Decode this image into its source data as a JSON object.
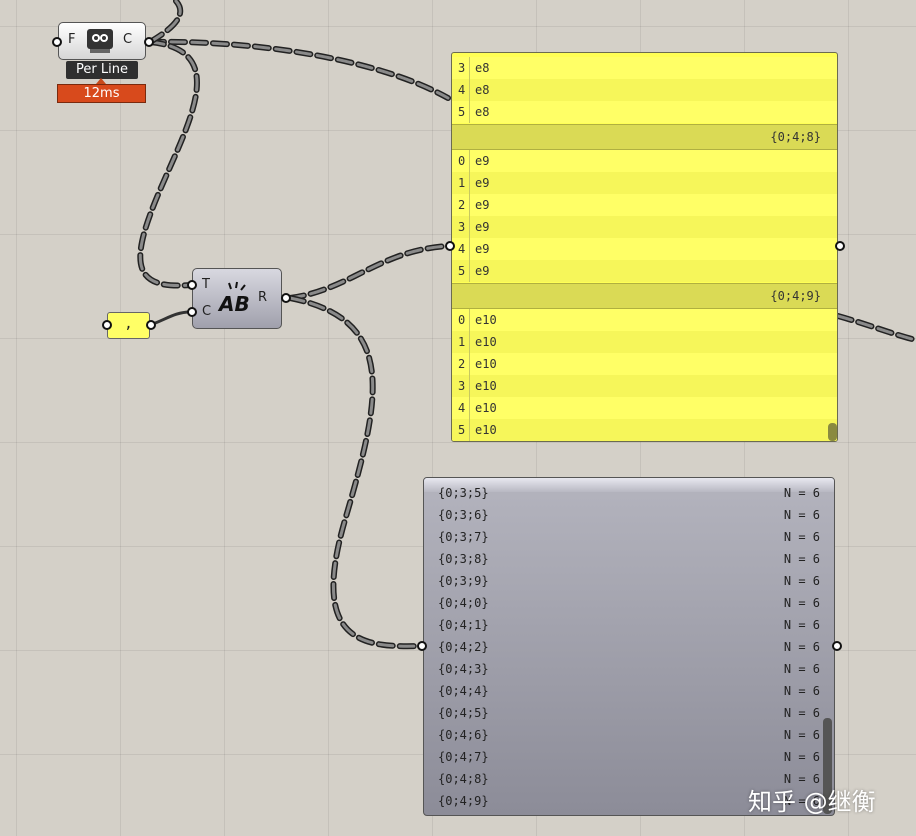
{
  "read_file": {
    "input_label": "F",
    "output_label": "C",
    "icon": "read-file-icon",
    "mode_tag": "Per Line",
    "timer": "12ms"
  },
  "text_join": {
    "input_t": "T",
    "input_c": "C",
    "output": "R",
    "icon": "text-join-ab-icon"
  },
  "comma_panel": {
    "text": ","
  },
  "yellow_panel": {
    "group_a": [
      {
        "i": "3",
        "v": "e8"
      },
      {
        "i": "4",
        "v": "e8"
      },
      {
        "i": "5",
        "v": "e8"
      }
    ],
    "path_a": "{0;4;8}",
    "group_b": [
      {
        "i": "0",
        "v": "e9"
      },
      {
        "i": "1",
        "v": "e9"
      },
      {
        "i": "2",
        "v": "e9"
      },
      {
        "i": "3",
        "v": "e9"
      },
      {
        "i": "4",
        "v": "e9"
      },
      {
        "i": "5",
        "v": "e9"
      }
    ],
    "path_b": "{0;4;9}",
    "group_c": [
      {
        "i": "0",
        "v": "e10"
      },
      {
        "i": "1",
        "v": "e10"
      },
      {
        "i": "2",
        "v": "e10"
      },
      {
        "i": "3",
        "v": "e10"
      },
      {
        "i": "4",
        "v": "e10"
      },
      {
        "i": "5",
        "v": "e10"
      }
    ]
  },
  "param_viewer": {
    "rows": [
      {
        "path": "{0;3;5}",
        "count": "N = 6"
      },
      {
        "path": "{0;3;6}",
        "count": "N = 6"
      },
      {
        "path": "{0;3;7}",
        "count": "N = 6"
      },
      {
        "path": "{0;3;8}",
        "count": "N = 6"
      },
      {
        "path": "{0;3;9}",
        "count": "N = 6"
      },
      {
        "path": "{0;4;0}",
        "count": "N = 6"
      },
      {
        "path": "{0;4;1}",
        "count": "N = 6"
      },
      {
        "path": "{0;4;2}",
        "count": "N = 6"
      },
      {
        "path": "{0;4;3}",
        "count": "N = 6"
      },
      {
        "path": "{0;4;4}",
        "count": "N = 6"
      },
      {
        "path": "{0;4;5}",
        "count": "N = 6"
      },
      {
        "path": "{0;4;6}",
        "count": "N = 6"
      },
      {
        "path": "{0;4;7}",
        "count": "N = 6"
      },
      {
        "path": "{0;4;8}",
        "count": "N = 6"
      },
      {
        "path": "{0;4;9}",
        "count": "N = 6"
      }
    ]
  },
  "watermark": "知乎 @继衡",
  "colors": {
    "canvas": "#d4d0c8",
    "panel_yellow": "#ffff55",
    "timer_red": "#d84a1c",
    "wire": "#555555"
  }
}
